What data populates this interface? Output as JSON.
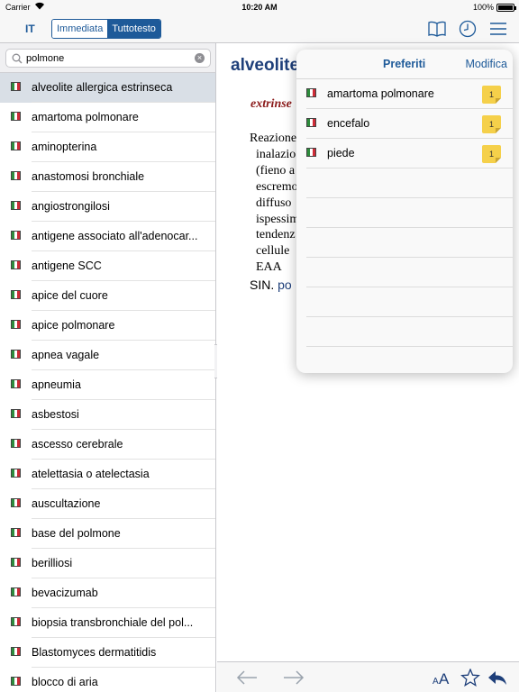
{
  "status_bar": {
    "carrier": "Carrier",
    "time": "10:20 AM",
    "battery": "100%"
  },
  "toolbar": {
    "language": "IT",
    "segments": [
      "Immediata",
      "Tuttotesto"
    ],
    "selected_segment": "Tuttotesto",
    "icons": [
      "dictionary-book-icon",
      "history-clock-icon",
      "menu-icon"
    ],
    "accent_color": "#1e5a99"
  },
  "search": {
    "value": "polmone"
  },
  "word_list": [
    "alveolite allergica estrinseca",
    "amartoma polmonare",
    "aminopterina",
    "anastomosi bronchiale",
    "angiostrongilosi",
    "antigene associato all'adenocar...",
    "antigene SCC",
    "apice del cuore",
    "apice polmonare",
    "apnea vagale",
    "apneumia",
    "asbestosi",
    "ascesso cerebrale",
    "atelettasia o atelectasia",
    "auscultazione",
    "base del polmone",
    "berilliosi",
    "bevacizumab",
    "biopsia transbronchiale del pol...",
    "Blastomyces dermatitidis",
    "blocco di aria"
  ],
  "selected_word_index": 0,
  "entry": {
    "headword": "alveolite",
    "subtitle": "extrinse",
    "definition_lines": [
      "Reazione",
      "inalazio",
      "(fieno a",
      "escremo",
      "diffuso",
      "ispessim",
      "tendenz",
      "cellule",
      "EAA"
    ],
    "sin_label": "SIN.",
    "sin_link": "po"
  },
  "bottom_bar": {
    "icons": [
      "back-arrow-icon",
      "forward-arrow-icon",
      "font-size-icon",
      "star-icon",
      "reply-icon"
    ]
  },
  "favorites": {
    "title": "Preferiti",
    "edit_label": "Modifica",
    "items": [
      {
        "word": "amartoma polmonare",
        "note": "1"
      },
      {
        "word": "encefalo",
        "note": "1"
      },
      {
        "word": "piede",
        "note": "1"
      }
    ],
    "empty_rows": 6
  }
}
